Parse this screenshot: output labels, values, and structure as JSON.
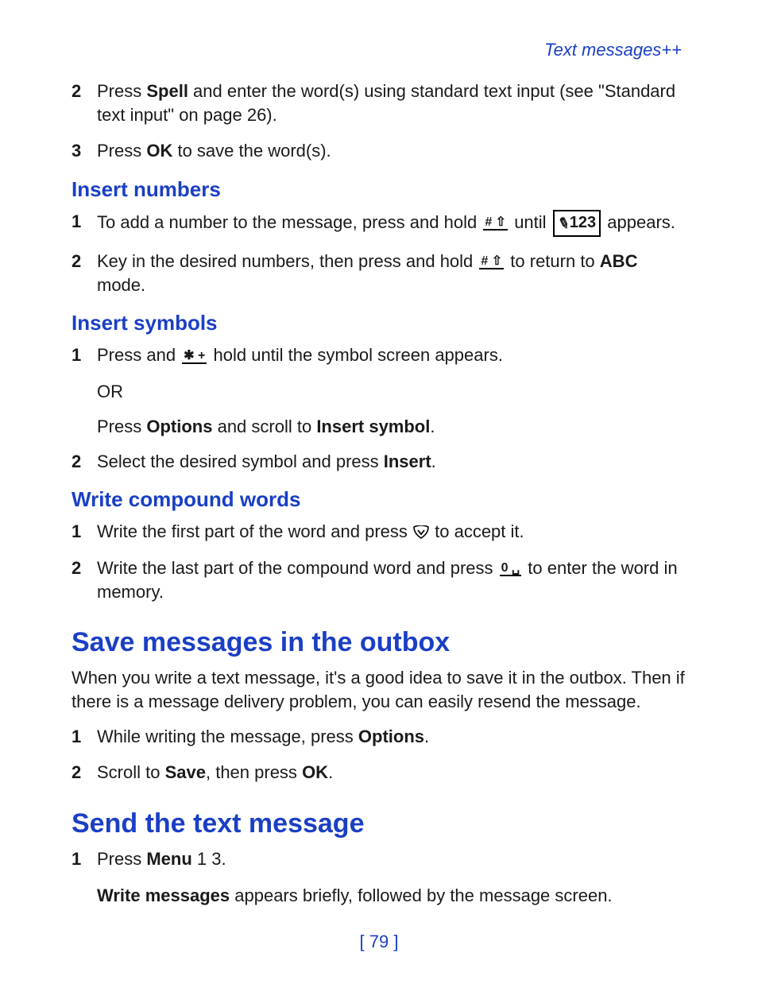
{
  "header": {
    "section": "Text messages++"
  },
  "top_list": [
    {
      "num": "2",
      "pre": "Press ",
      "bold1": "Spell",
      "mid": " and enter the word(s) using standard text input (see \"Standard text input\" on page 26)."
    },
    {
      "num": "3",
      "pre": "Press ",
      "bold1": "OK",
      "mid": " to save the word(s)."
    }
  ],
  "numbers": {
    "title": "Insert numbers",
    "items": [
      {
        "num": "1",
        "a": "To add a number to the message, press and hold ",
        "b": " until ",
        "c": " appears."
      },
      {
        "num": "2",
        "a": "Key in the desired numbers, then press and hold ",
        "b": " to return to ",
        "bold": "ABC",
        "c": " mode."
      }
    ]
  },
  "symbols": {
    "title": "Insert symbols",
    "items": [
      {
        "num": "1",
        "a": "Press and ",
        "b": " hold until the symbol screen appears."
      },
      {
        "num": "2",
        "a": "Select the desired symbol and press ",
        "bold": "Insert",
        "c": "."
      }
    ],
    "or": "OR",
    "opt_a": "Press ",
    "opt_bold1": "Options",
    "opt_b": " and scroll to ",
    "opt_bold2": "Insert symbol",
    "opt_c": "."
  },
  "compound": {
    "title": "Write compound words",
    "items": [
      {
        "num": "1",
        "a": "Write the first part of the word and press ",
        "b": " to accept it."
      },
      {
        "num": "2",
        "a": "Write the last part of the compound word and press ",
        "b": " to enter the word in memory."
      }
    ]
  },
  "outbox": {
    "title": "Save messages in the outbox",
    "intro": "When you write a text message, it's a good idea to save it in the outbox. Then if there is a message delivery problem, you can easily resend the message.",
    "items": [
      {
        "num": "1",
        "a": "While writing the message, press ",
        "bold": "Options",
        "c": "."
      },
      {
        "num": "2",
        "a": "Scroll to ",
        "bold1": "Save",
        "b": ", then press ",
        "bold2": "OK",
        "c": "."
      }
    ]
  },
  "send": {
    "title": "Send the text message",
    "items": [
      {
        "num": "1",
        "a": "Press ",
        "bold": "Menu",
        "b": " 1 3."
      }
    ],
    "note_bold": "Write messages",
    "note_rest": " appears briefly, followed by the message screen."
  },
  "icons": {
    "hash_key": "# ⇧",
    "star_key": "✱ +",
    "zero_key": "0 ␣",
    "badge_label": "123"
  },
  "footer": {
    "page": "[ 79 ]"
  }
}
